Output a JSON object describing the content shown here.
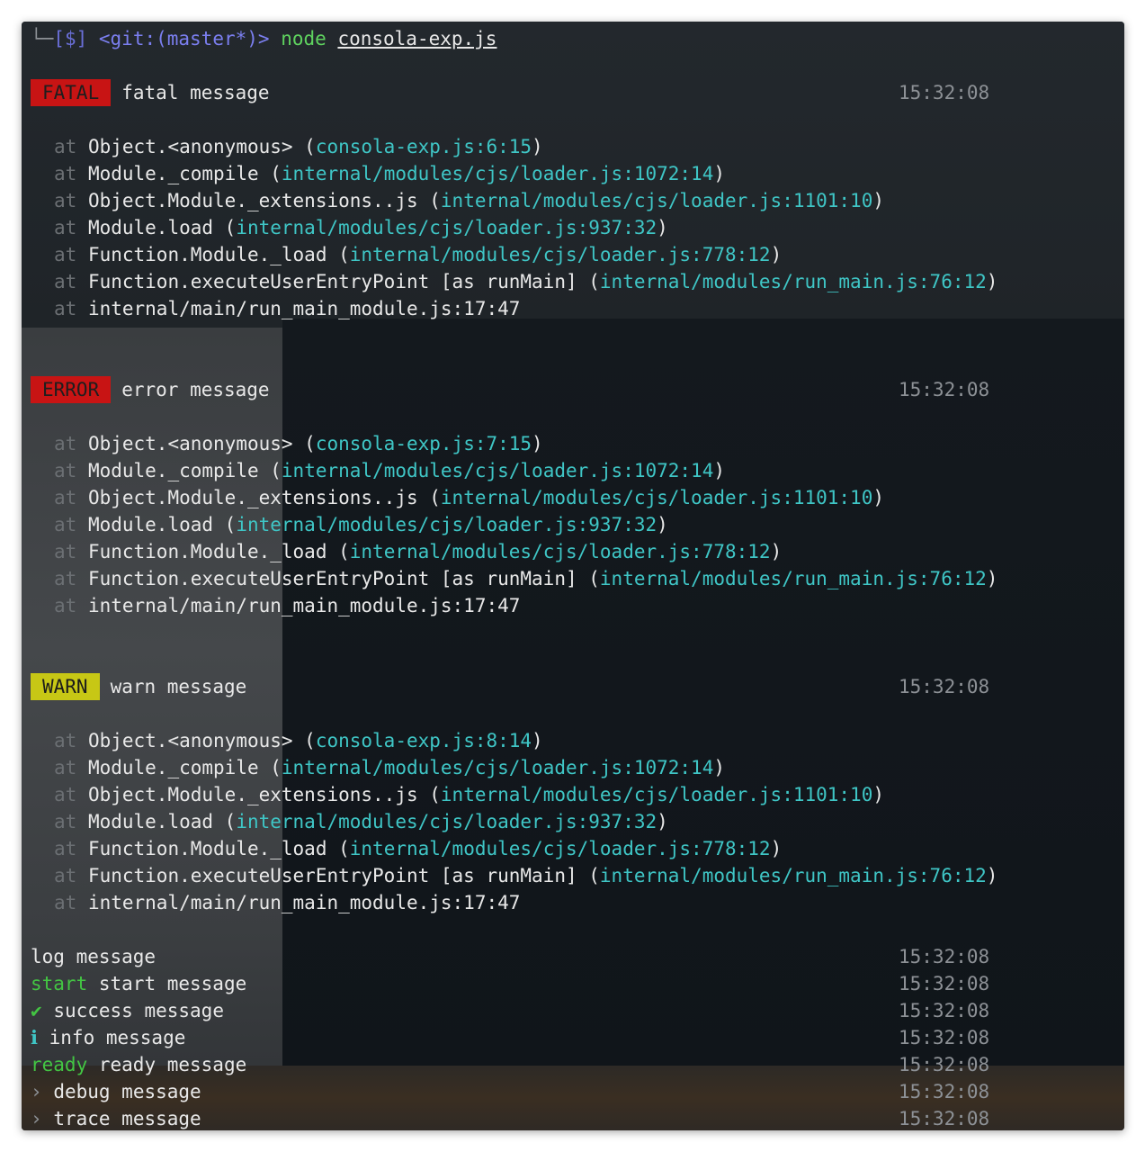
{
  "prompt": {
    "corner": "└─",
    "dollar": "[$]",
    "git": "<git:(master*)>",
    "command": "node",
    "file": "consola-exp.js"
  },
  "colors": {
    "fatal_badge": "#c81414",
    "error_badge": "#c81414",
    "warn_badge": "#c7c715",
    "location_text": "#3fc6c6",
    "green_text": "#43c543",
    "prompt_git": "#7b7ff0"
  },
  "blocks": [
    {
      "badge": "FATAL",
      "message": "fatal message",
      "time": "15:32:08",
      "stack": [
        {
          "fn": "Object.<anonymous>",
          "loc": "consola-exp.js:6:15"
        },
        {
          "fn": "Module._compile",
          "loc": "internal/modules/cjs/loader.js:1072:14"
        },
        {
          "fn": "Object.Module._extensions..js",
          "loc": "internal/modules/cjs/loader.js:1101:10"
        },
        {
          "fn": "Module.load",
          "loc": "internal/modules/cjs/loader.js:937:32"
        },
        {
          "fn": "Function.Module._load",
          "loc": "internal/modules/cjs/loader.js:778:12"
        },
        {
          "fn": "Function.executeUserEntryPoint [as runMain]",
          "loc": "internal/modules/run_main.js:76:12"
        },
        {
          "fn": "internal/main/run_main_module.js:17:47",
          "loc": ""
        }
      ]
    },
    {
      "badge": "ERROR",
      "message": "error message",
      "time": "15:32:08",
      "stack": [
        {
          "fn": "Object.<anonymous>",
          "loc": "consola-exp.js:7:15"
        },
        {
          "fn": "Module._compile",
          "loc": "internal/modules/cjs/loader.js:1072:14"
        },
        {
          "fn": "Object.Module._extensions..js",
          "loc": "internal/modules/cjs/loader.js:1101:10"
        },
        {
          "fn": "Module.load",
          "loc": "internal/modules/cjs/loader.js:937:32"
        },
        {
          "fn": "Function.Module._load",
          "loc": "internal/modules/cjs/loader.js:778:12"
        },
        {
          "fn": "Function.executeUserEntryPoint [as runMain]",
          "loc": "internal/modules/run_main.js:76:12"
        },
        {
          "fn": "internal/main/run_main_module.js:17:47",
          "loc": ""
        }
      ]
    },
    {
      "badge": "WARN",
      "message": "warn message",
      "time": "15:32:08",
      "stack": [
        {
          "fn": "Object.<anonymous>",
          "loc": "consola-exp.js:8:14"
        },
        {
          "fn": "Module._compile",
          "loc": "internal/modules/cjs/loader.js:1072:14"
        },
        {
          "fn": "Object.Module._extensions..js",
          "loc": "internal/modules/cjs/loader.js:1101:10"
        },
        {
          "fn": "Module.load",
          "loc": "internal/modules/cjs/loader.js:937:32"
        },
        {
          "fn": "Function.Module._load",
          "loc": "internal/modules/cjs/loader.js:778:12"
        },
        {
          "fn": "Function.executeUserEntryPoint [as runMain]",
          "loc": "internal/modules/run_main.js:76:12"
        },
        {
          "fn": "internal/main/run_main_module.js:17:47",
          "loc": ""
        }
      ]
    }
  ],
  "at_word": "at",
  "simple": [
    {
      "prefix": "",
      "message": "log message",
      "time": "15:32:08"
    },
    {
      "prefix": "start",
      "message": "start message",
      "time": "15:32:08"
    },
    {
      "prefix": "✔",
      "message": "success message",
      "time": "15:32:08"
    },
    {
      "prefix": "ℹ",
      "message": "info message",
      "time": "15:32:08"
    },
    {
      "prefix": "ready",
      "message": "ready message",
      "time": "15:32:08"
    },
    {
      "prefix": "›",
      "message": "debug message",
      "time": "15:32:08"
    },
    {
      "prefix": "›",
      "message": "trace message",
      "time": "15:32:08"
    }
  ]
}
